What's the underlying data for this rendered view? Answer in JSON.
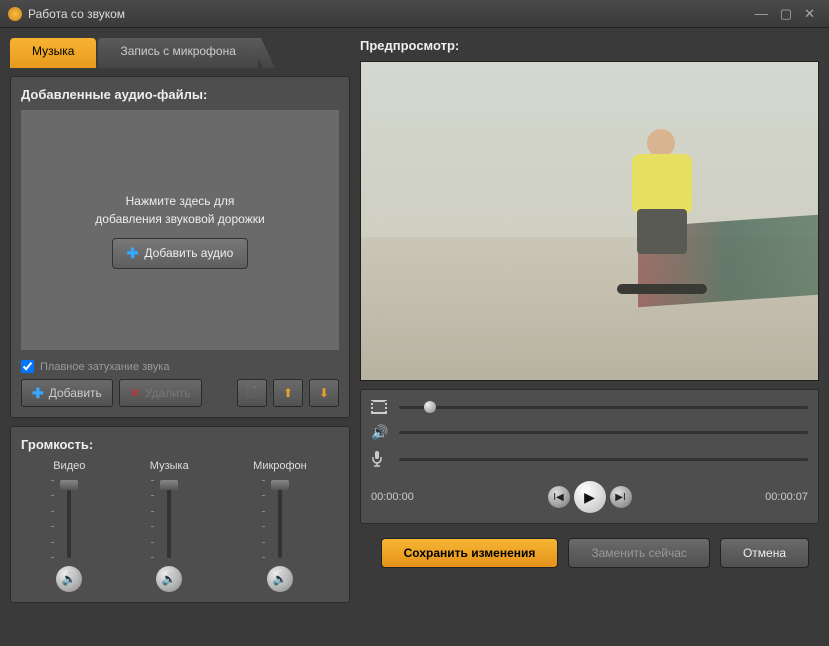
{
  "window": {
    "title": "Работа со звуком"
  },
  "tabs": {
    "music": "Музыка",
    "mic": "Запись с микрофона"
  },
  "added": {
    "header": "Добавленные аудио-файлы:",
    "hint1": "Нажмите здесь для",
    "hint2": "добавления звуковой дорожки",
    "add_audio": "Добавить аудио",
    "fade": "Плавное затухание звука"
  },
  "toolbar": {
    "add": "Добавить",
    "delete": "Удалить"
  },
  "volume": {
    "header": "Громкость:",
    "video": "Видео",
    "music": "Музыка",
    "mic": "Микрофон"
  },
  "preview": {
    "header": "Предпросмотр:"
  },
  "time": {
    "current": "00:00:00",
    "total": "00:00:07"
  },
  "footer": {
    "save": "Сохранить изменения",
    "replace": "Заменить сейчас",
    "cancel": "Отмена"
  }
}
